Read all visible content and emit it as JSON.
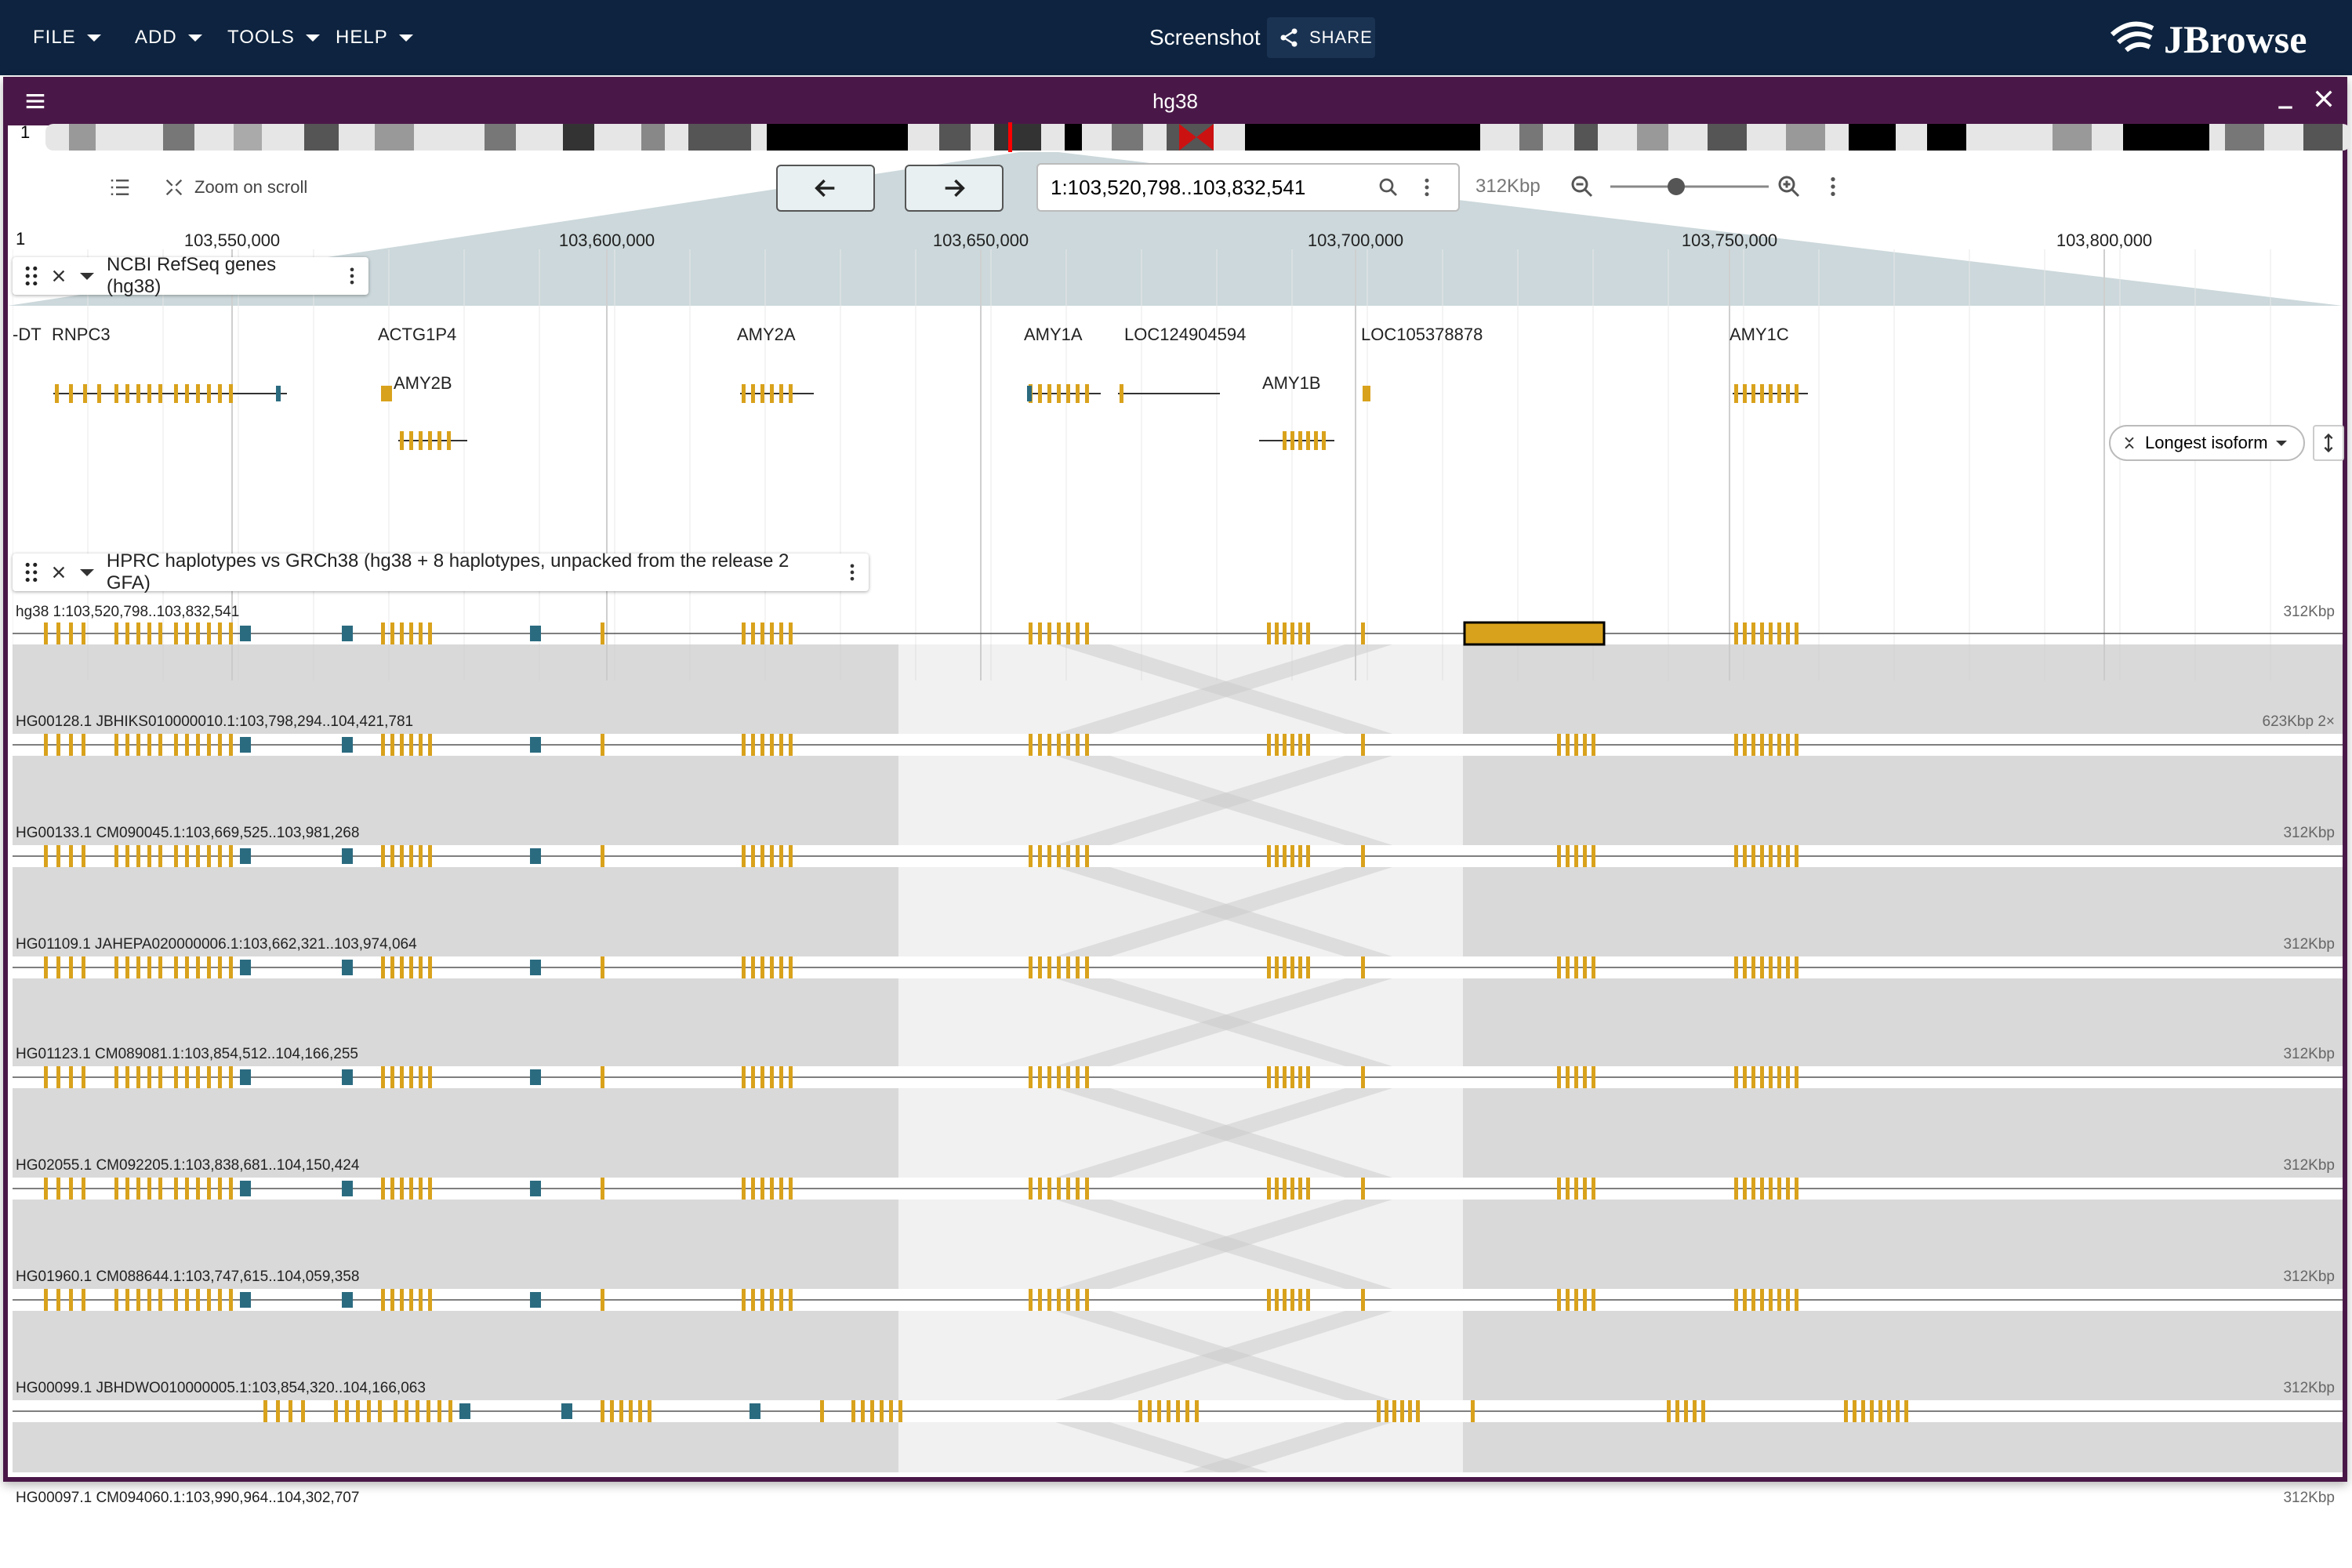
{
  "app": {
    "menu": [
      "FILE",
      "ADD",
      "TOOLS",
      "HELP"
    ],
    "session_name": "Screenshot",
    "share_label": "SHARE",
    "logo_text": "JBrowse"
  },
  "view": {
    "assembly": "hg38",
    "chromosome": "1",
    "zoom_on_scroll_label": "Zoom on scroll",
    "location": "1:103,520,798..103,832,541",
    "bp_per_view": "312Kbp",
    "ruler_ticks": [
      "103,550,000",
      "103,600,000",
      "103,650,000",
      "103,700,000",
      "103,750,000",
      "103,800,000"
    ]
  },
  "genes_track": {
    "name": "NCBI RefSeq genes (hg38)",
    "genes": [
      "-DT",
      "RNPC3",
      "ACTG1P4",
      "AMY2B",
      "AMY2A",
      "AMY1A",
      "LOC124904594",
      "AMY1B",
      "LOC105378878",
      "AMY1C"
    ],
    "isoform_option": "Longest isoform"
  },
  "haplotype_track": {
    "name": "HPRC haplotypes vs GRCh38 (hg38 + 8 haplotypes, unpacked from the release 2 GFA)",
    "rows": [
      {
        "label": "hg38 1:103,520,798..103,832,541",
        "size": "312Kbp"
      },
      {
        "label": "HG00128.1 JBHIKS010000010.1:103,798,294..104,421,781",
        "size": "623Kbp 2×"
      },
      {
        "label": "HG00133.1 CM090045.1:103,669,525..103,981,268",
        "size": "312Kbp"
      },
      {
        "label": "HG01109.1 JAHEPA020000006.1:103,662,321..103,974,064",
        "size": "312Kbp"
      },
      {
        "label": "HG01123.1 CM089081.1:103,854,512..104,166,255",
        "size": "312Kbp"
      },
      {
        "label": "HG02055.1 CM092205.1:103,838,681..104,150,424",
        "size": "312Kbp"
      },
      {
        "label": "HG01960.1 CM088644.1:103,747,615..104,059,358",
        "size": "312Kbp"
      },
      {
        "label": "HG00099.1 JBHDWO010000005.1:103,854,320..104,166,063",
        "size": "312Kbp"
      },
      {
        "label": "HG00097.1 CM094060.1:103,990,964..104,302,707",
        "size": "312Kbp"
      }
    ]
  },
  "colors": {
    "appbar": "#0d233f",
    "view_border": "#4a1848",
    "exon": "#d9a21c",
    "utr": "#2b6b80",
    "synteny": "#cfcfcf"
  }
}
